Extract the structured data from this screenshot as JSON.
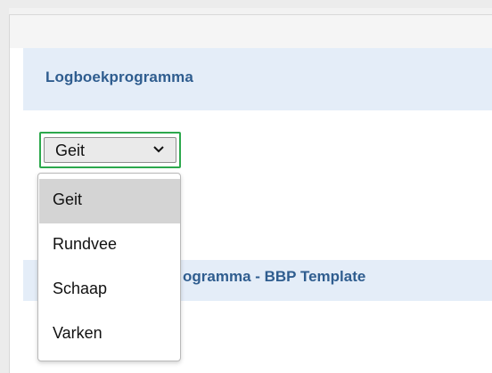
{
  "header": {
    "title": "Logboekprogramma"
  },
  "select": {
    "value": "Geit",
    "options": [
      "Geit",
      "Rundvee",
      "Schaap",
      "Varken"
    ],
    "selected_index": 0
  },
  "section2": {
    "title_visible": "ogramma - BBP Template"
  },
  "colors": {
    "header_bg": "#e4edf8",
    "title_text": "#2f5d8f",
    "focus_border": "#2ca84c",
    "option_selected_bg": "#d4d4d4"
  },
  "icons": {
    "select_arrow": "chevron-down-icon"
  }
}
